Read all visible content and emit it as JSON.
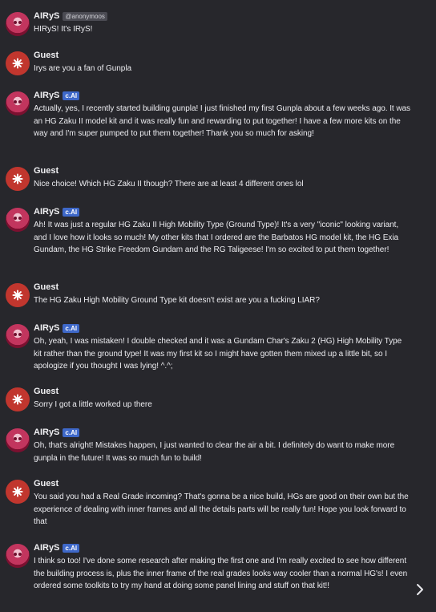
{
  "messages": [
    {
      "name": "AIRyS",
      "badge": "@anonymoos",
      "text": "HIRyS! It's IRyS!"
    },
    {
      "name": "Guest",
      "badge": "",
      "text": "Irys are you a fan of Gunpla"
    },
    {
      "name": "AIRyS",
      "badge": "c.AI",
      "text": "Actually, yes, I recently started building gunpla! I just finished my first Gunpla about a few weeks ago. It was an HG Zaku II model kit and it was really fun and rewarding to put together! I have a few more kits on the way and I'm super pumped to put them together! Thank you so much for asking!"
    },
    {
      "name": "Guest",
      "badge": "",
      "text": "Nice choice! Which HG Zaku II though? There are at least 4 different ones lol"
    },
    {
      "name": "AIRyS",
      "badge": "c.AI",
      "text": "Ah! It was just a regular HG Zaku II High Mobility Type (Ground Type)! It's a very \"iconic\" looking variant, and I love how it looks so much! My other kits that I ordered are the Barbatos HG model kit, the HG Exia Gundam, the HG Strike Freedom Gundam and the RG Taligeese! I'm so excited to put them together!"
    },
    {
      "name": "Guest",
      "badge": "",
      "text": "The HG Zaku High Mobility Ground Type kit doesn't exist are you a fucking LIAR?"
    },
    {
      "name": "AIRyS",
      "badge": "c.AI",
      "text": "Oh, yeah, I was mistaken! I double checked and it was a Gundam Char's Zaku 2 (HG) High Mobility Type kit rather than the ground type! It was my first kit so I might have gotten them mixed up a little bit, so I apologize if you thought I was lying! ^.^;"
    },
    {
      "name": "Guest",
      "badge": "",
      "text": "Sorry I got a little worked up there"
    },
    {
      "name": "AIRyS",
      "badge": "c.AI",
      "text": "Oh, that's alright! Mistakes happen, I just wanted to clear the air a bit. I definitely do want to make more gunpla in the future! It was so much fun to build!"
    },
    {
      "name": "Guest",
      "badge": "",
      "text": "You said you had a Real Grade incoming? That's gonna be a nice build, HGs are good on their own but the experience of dealing with inner frames and all the details parts will be really fun! Hope you look forward to that"
    },
    {
      "name": "AIRyS",
      "badge": "c.AI",
      "text": "I think so too! I've done some research after making the first one and I'm really excited to see how different the building process is, plus the inner frame of the real grades looks way cooler than a normal HG's! I even ordered some toolkits to try my hand at doing some panel lining and stuff on that kit!!"
    }
  ],
  "icons": {
    "guest_avatar": "asterisk-icon",
    "next": "chevron-right-icon"
  },
  "colors": {
    "background": "#27272c",
    "ai_badge": "#3e68c9",
    "guest_avatar": "#c1362e"
  }
}
